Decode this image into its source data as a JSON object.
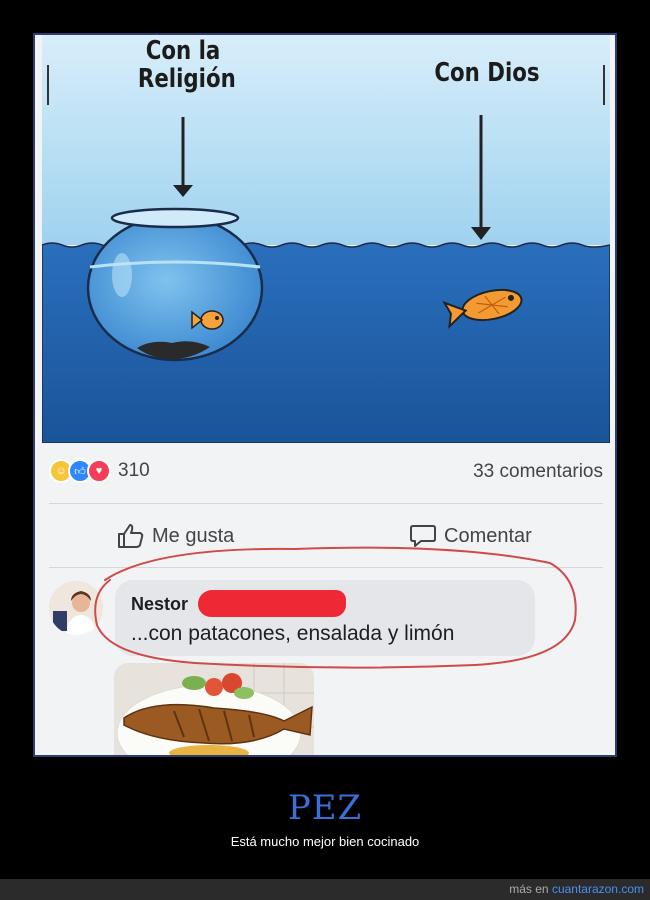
{
  "cartoon": {
    "left_label_line1": "Con la",
    "left_label_line2": "Religión",
    "right_label": "Con Dios"
  },
  "post": {
    "reactions": [
      "haha-icon",
      "like-icon",
      "love-icon"
    ],
    "reaction_count": "310",
    "comments_count": "33 comentarios",
    "like_label": "Me gusta",
    "comment_label": "Comentar"
  },
  "comment": {
    "author": "Nestor",
    "text": "...con patacones, ensalada y limón"
  },
  "page": {
    "title": "PEZ",
    "subtitle": "Está mucho mejor bien cocinado",
    "footer_prefix": "más en ",
    "footer_link": "cuantarazon.com"
  },
  "colors": {
    "water": "#1f63b0",
    "sky": "#bfe3f6",
    "title": "#3b6fd9",
    "redaction": "#ee2935"
  }
}
